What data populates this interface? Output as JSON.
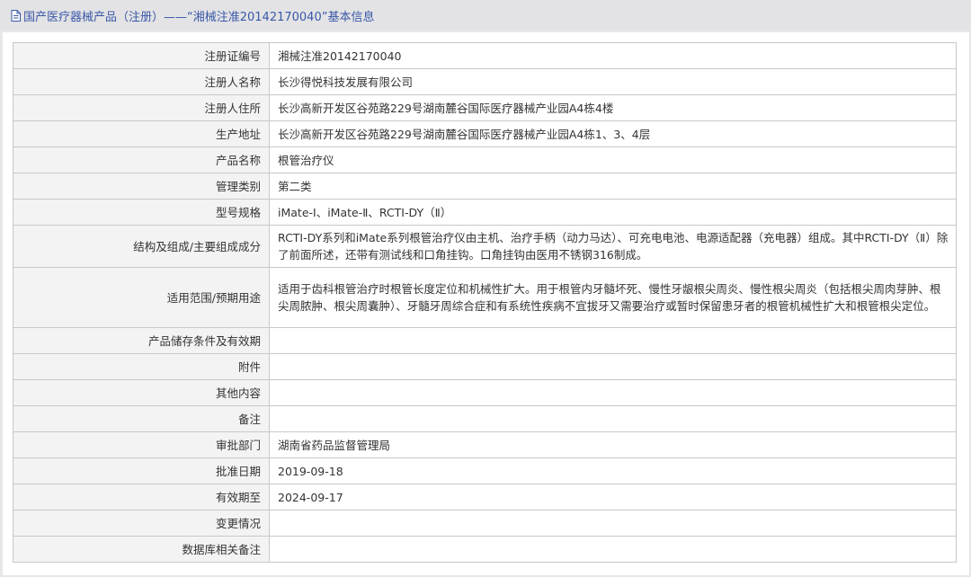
{
  "header": {
    "title": "国产医疗器械产品（注册）——“湘械注准20142170040”基本信息",
    "icon": "document-icon",
    "color": "#3a58a8"
  },
  "rows": [
    {
      "label": "注册证编号",
      "value": "湘械注准20142170040"
    },
    {
      "label": "注册人名称",
      "value": "长沙得悦科技发展有限公司"
    },
    {
      "label": "注册人住所",
      "value": "长沙高新开发区谷苑路229号湖南麓谷国际医疗器械产业园A4栋4楼"
    },
    {
      "label": "生产地址",
      "value": "长沙高新开发区谷苑路229号湖南麓谷国际医疗器械产业园A4栋1、3、4层"
    },
    {
      "label": "产品名称",
      "value": "根管治疗仪"
    },
    {
      "label": "管理类别",
      "value": "第二类"
    },
    {
      "label": "型号规格",
      "value": "iMate-Ⅰ、iMate-Ⅱ、RCTI-DY（Ⅱ）"
    },
    {
      "label": "结构及组成/主要组成成分",
      "value": "RCTI-DY系列和iMate系列根管治疗仪由主机、治疗手柄（动力马达）、可充电电池、电源适配器（充电器）组成。其中RCTI-DY（Ⅱ）除了前面所述，还带有测试线和口角挂钩。口角挂钩由医用不锈钢316制成。"
    },
    {
      "label": "适用范围/预期用途",
      "value": "适用于齿科根管治疗时根管长度定位和机械性扩大。用于根管内牙髓坏死、慢性牙龈根尖周炎、慢性根尖周炎（包括根尖周肉芽肿、根尖周脓肿、根尖周囊肿）、牙髓牙周综合症和有系统性疾病不宜拔牙又需要治疗或暂时保留患牙者的根管机械性扩大和根管根尖定位。"
    },
    {
      "label": "产品储存条件及有效期",
      "value": ""
    },
    {
      "label": "附件",
      "value": ""
    },
    {
      "label": "其他内容",
      "value": ""
    },
    {
      "label": "备注",
      "value": ""
    },
    {
      "label": "审批部门",
      "value": "湖南省药品监督管理局"
    },
    {
      "label": "批准日期",
      "value": "2019-09-18"
    },
    {
      "label": "有效期至",
      "value": "2024-09-17"
    },
    {
      "label": "变更情况",
      "value": ""
    },
    {
      "label": "数据库相关备注",
      "value": ""
    }
  ]
}
